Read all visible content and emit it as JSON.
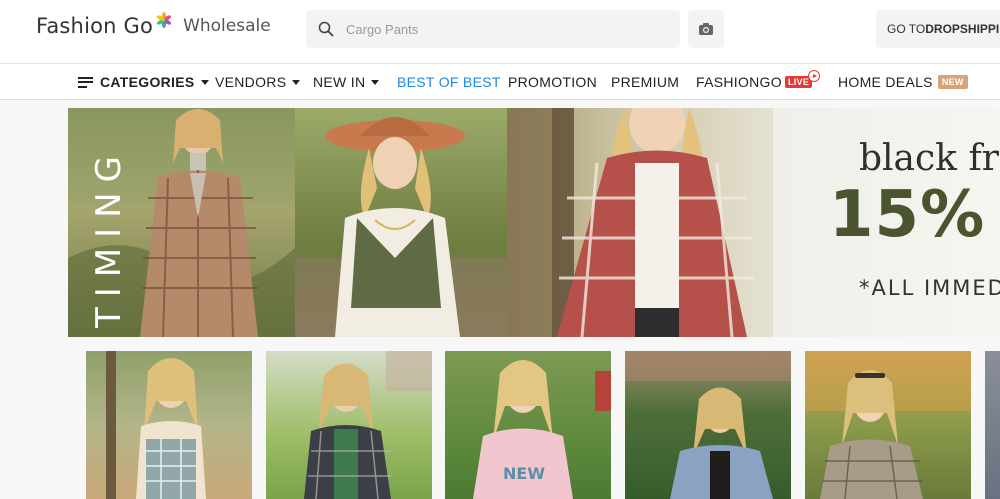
{
  "header": {
    "logo_main": "Fashion Go",
    "logo_sub": "Wholesale",
    "search_placeholder": "Cargo Pants",
    "dropship_prefix": "GO TO ",
    "dropship_bold": "DROPSHIPPIN"
  },
  "nav": {
    "categories": "CATEGORIES",
    "vendors": "VENDORS",
    "new_in": "NEW IN",
    "best_of_best": "BEST OF BEST",
    "promotion": "PROMOTION",
    "premium": "PREMIUM",
    "fashiongo": "FASHIONGO",
    "live_badge": "LIVE",
    "home_deals": "HOME DEALS",
    "new_badge": "NEW"
  },
  "banner": {
    "vertical_text": "TIMING",
    "promo_line1": "black fri",
    "promo_line2": "15% O",
    "promo_line3": "*ALL IMMED"
  },
  "colors": {
    "accent_blue": "#1e88e5",
    "live_red": "#e53935",
    "new_tan": "#d9a37a",
    "promo_olive": "#4a5530"
  },
  "icons": [
    "search-icon",
    "camera-icon",
    "menu-icon",
    "play-icon"
  ]
}
